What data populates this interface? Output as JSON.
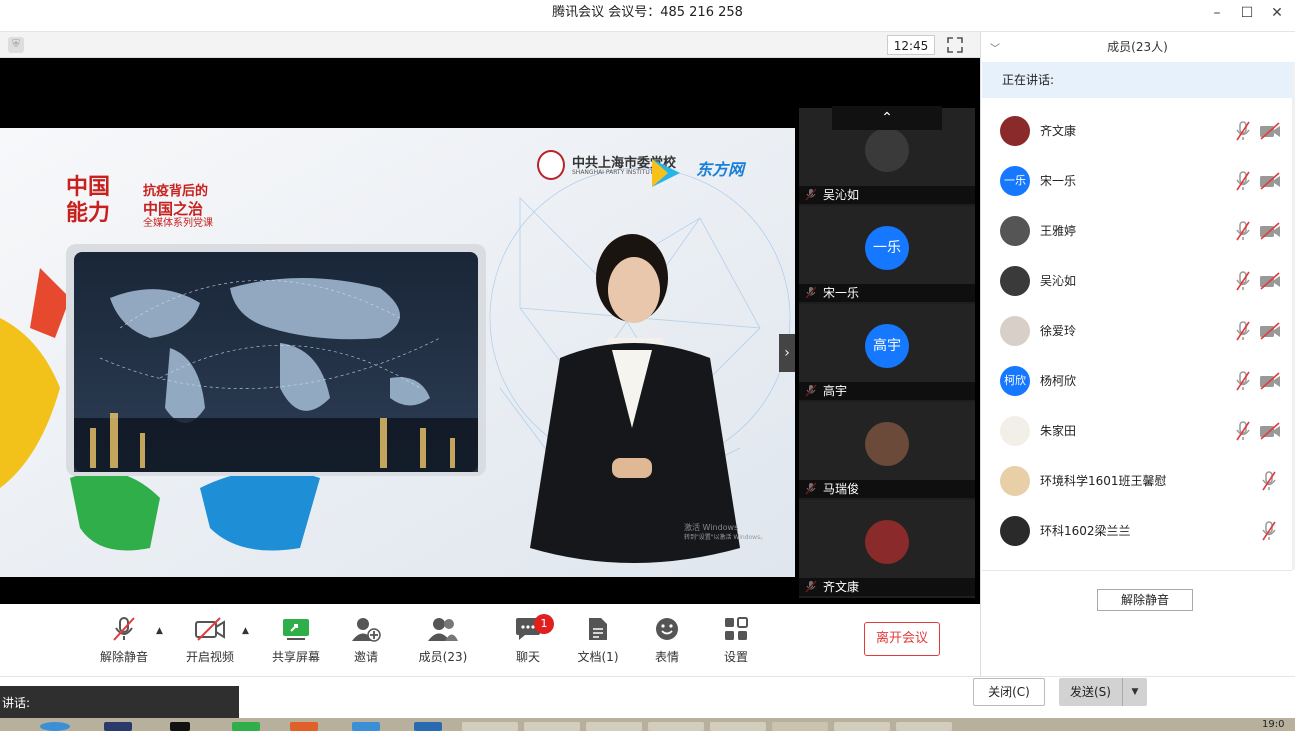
{
  "window": {
    "title": "腾讯会议 会议号：485 216 258",
    "minimize_icon": "–",
    "maximize_icon": "☐",
    "close_icon": "✕"
  },
  "meeting_bar": {
    "timer": "12:45"
  },
  "slide": {
    "logo_line1": "中国",
    "logo_line2": "能力",
    "headline_1": "抗疫背后的",
    "headline_2": "中国之治",
    "headline_3": "全媒体系列党课",
    "org_cn": "中共上海市委党校",
    "org_en": "SHANGHAI PARTY INSTITUTE",
    "partner": "东方网",
    "watermark_1": "激活 Windows",
    "watermark_2": "转到\"设置\"以激活 Windows。"
  },
  "video_strip": {
    "scroll_up_icon": "⌃",
    "next_icon": "›",
    "tiles": [
      {
        "name": "吴沁如",
        "avatar_text": ""
      },
      {
        "name": "宋一乐",
        "avatar_text": "一乐"
      },
      {
        "name": "高宇",
        "avatar_text": "高宇"
      },
      {
        "name": "马瑞俊",
        "avatar_text": ""
      },
      {
        "name": "齐文康",
        "avatar_text": ""
      }
    ]
  },
  "toolbar": {
    "unmute": "解除静音",
    "start_video": "开启视频",
    "share_screen": "共享屏幕",
    "invite": "邀请",
    "members": "成员(23)",
    "chat": "聊天",
    "chat_badge": "1",
    "docs": "文档(1)",
    "reactions": "表情",
    "settings": "设置",
    "leave": "离开会议",
    "caret": "▲"
  },
  "members_panel": {
    "title": "成员(23人)",
    "collapse_icon": "﹀",
    "speaking_label": "正在讲话:",
    "unmute_all": "解除静音",
    "members": [
      {
        "name": "齐文康",
        "avatar_text": "",
        "avatar_color": "#8b2a2a",
        "video_icon": true
      },
      {
        "name": "宋一乐",
        "avatar_text": "一乐",
        "avatar_color": "#1677ff",
        "video_icon": true
      },
      {
        "name": "王雅婷",
        "avatar_text": "",
        "avatar_color": "#555555",
        "video_icon": true
      },
      {
        "name": "吴沁如",
        "avatar_text": "",
        "avatar_color": "#3a3a3a",
        "video_icon": true
      },
      {
        "name": "徐爱玲",
        "avatar_text": "",
        "avatar_color": "#d8d0c8",
        "video_icon": true
      },
      {
        "name": "杨柯欣",
        "avatar_text": "柯欣",
        "avatar_color": "#1677ff",
        "video_icon": true
      },
      {
        "name": "朱家田",
        "avatar_text": "",
        "avatar_color": "#f2efe9",
        "video_icon": true
      },
      {
        "name": "环境科学1601班王馨慰",
        "avatar_text": "",
        "avatar_color": "#e8cfa8",
        "video_icon": false
      },
      {
        "name": "环科1602梁兰兰",
        "avatar_text": "",
        "avatar_color": "#2a2a2a",
        "video_icon": false
      }
    ]
  },
  "chat_panel": {
    "close_label": "关闭(C)",
    "send_label": "发送(S)",
    "send_caret": "▼",
    "toast_text": "讲话:"
  },
  "taskbar": {
    "time": "19:0"
  },
  "colors": {
    "accent": "#1677ff",
    "danger": "#e03c3c",
    "speaking_bg": "#e6f1fc",
    "stage_bg": "#000000"
  }
}
